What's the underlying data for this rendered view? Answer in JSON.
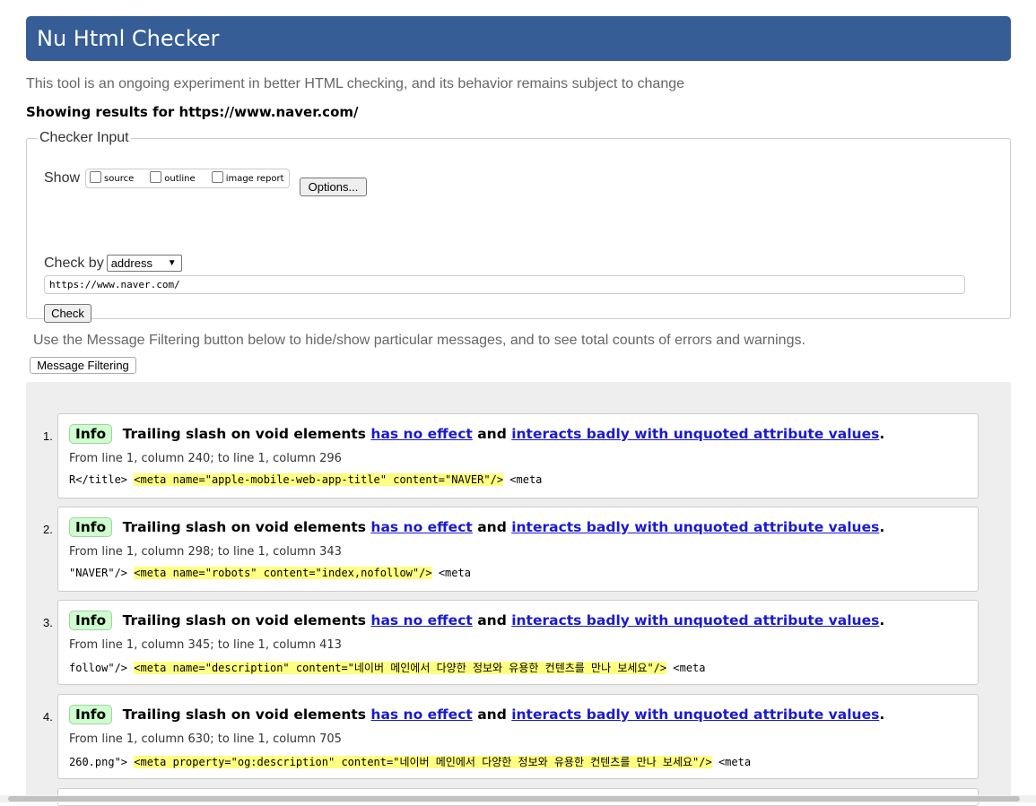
{
  "header": {
    "title": "Nu Html Checker"
  },
  "tagline": "This tool is an ongoing experiment in better HTML checking, and its behavior remains subject to change",
  "showing_results": "Showing results for https://www.naver.com/",
  "checker_input": {
    "legend": "Checker Input",
    "show_label": "Show",
    "show_options": [
      "source",
      "outline",
      "image report"
    ],
    "options_button": "Options...",
    "check_by_label": "Check by",
    "check_by_value": "address",
    "url_value": "https://www.naver.com/",
    "check_button": "Check"
  },
  "filter_note": "Use the Message Filtering button below to hide/show particular messages, and to see total counts of errors and warnings.",
  "filter_button": "Message Filtering",
  "messages": [
    {
      "number": "1.",
      "type": "Info",
      "text_pre": "Trailing slash on void elements",
      "link1": "has no effect",
      "text_mid": "and",
      "link2": "interacts badly with unquoted attribute values",
      "text_post": ".",
      "location": "From line 1, column 240; to line 1, column 296",
      "extract_pre": "R</title> ",
      "extract_highlight": "<meta name=\"apple-mobile-web-app-title\" content=\"NAVER\"/>",
      "extract_post": " <meta"
    },
    {
      "number": "2.",
      "type": "Info",
      "text_pre": "Trailing slash on void elements",
      "link1": "has no effect",
      "text_mid": "and",
      "link2": "interacts badly with unquoted attribute values",
      "text_post": ".",
      "location": "From line 1, column 298; to line 1, column 343",
      "extract_pre": "\"NAVER\"/> ",
      "extract_highlight": "<meta name=\"robots\" content=\"index,nofollow\"/>",
      "extract_post": " <meta"
    },
    {
      "number": "3.",
      "type": "Info",
      "text_pre": "Trailing slash on void elements",
      "link1": "has no effect",
      "text_mid": "and",
      "link2": "interacts badly with unquoted attribute values",
      "text_post": ".",
      "location": "From line 1, column 345; to line 1, column 413",
      "extract_pre": "follow\"/> ",
      "extract_highlight": "<meta name=\"description\" content=\"네이버 메인에서 다양한 정보와 유용한 컨텐츠를 만나 보세요\"/>",
      "extract_post": " <meta"
    },
    {
      "number": "4.",
      "type": "Info",
      "text_pre": "Trailing slash on void elements",
      "link1": "has no effect",
      "text_mid": "and",
      "link2": "interacts badly with unquoted attribute values",
      "text_post": ".",
      "location": "From line 1, column 630; to line 1, column 705",
      "extract_pre": "260.png\"> ",
      "extract_highlight": "<meta property=\"og:description\" content=\"네이버 메인에서 다양한 정보와 유용한 컨텐츠를 만나 보세요\"/>",
      "extract_post": " <meta"
    }
  ]
}
